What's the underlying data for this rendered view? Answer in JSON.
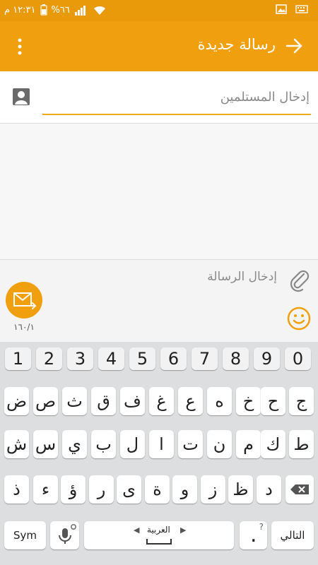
{
  "status_bar": {
    "time": "١٢:٣١ م",
    "battery": "%٦٦",
    "wifi_icon": "wifi-icon",
    "signal_icon": "signal-icon",
    "battery_icon": "battery-icon",
    "notification_icons": [
      "keyboard-icon",
      "image-icon"
    ]
  },
  "app_bar": {
    "title": "رسالة جديدة",
    "back_icon": "arrow-right-icon",
    "menu_icon": "more-vert-icon"
  },
  "recipients": {
    "placeholder": "إدخال المستلمين",
    "contact_icon": "contact-icon"
  },
  "compose": {
    "placeholder": "إدخال الرسالة",
    "attach_icon": "paperclip-icon",
    "emoji_icon": "smiley-icon",
    "send_icon": "send-mms-icon",
    "counter": "١٦٠/١"
  },
  "keyboard": {
    "numbers": [
      "1",
      "2",
      "3",
      "4",
      "5",
      "6",
      "7",
      "8",
      "9",
      "0"
    ],
    "row1": [
      "ض",
      "ص",
      "ث",
      "ق",
      "ف",
      "غ",
      "ع",
      "ه",
      "خ",
      "ح",
      "ج"
    ],
    "row2": [
      "ش",
      "س",
      "ي",
      "ب",
      "ل",
      "ا",
      "ت",
      "ن",
      "م",
      "ك",
      "ط"
    ],
    "row3": [
      "ذ",
      "ء",
      "ؤ",
      "ر",
      "ى",
      "ة",
      "و",
      "ز",
      "ظ",
      "د"
    ],
    "sym": "Sym",
    "language": "العربية",
    "next": "التالي",
    "period": ".",
    "period_hint": "?",
    "mic_icon": "mic-icon",
    "settings_icon": "gear-icon",
    "backspace_icon": "backspace-icon"
  },
  "colors": {
    "status_bar": "#e89a0b",
    "app_bar": "#f0a00e",
    "accent": "#efa91c",
    "keyboard_bg": "#dcdee0"
  }
}
